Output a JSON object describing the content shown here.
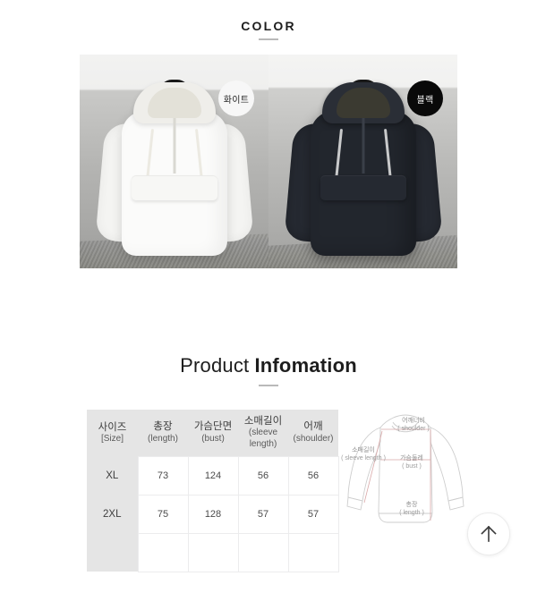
{
  "color_section": {
    "heading": "COLOR",
    "swatches": [
      {
        "badge_label": "화이트",
        "name": "white-colorway"
      },
      {
        "badge_label": "블랙",
        "name": "black-colorway"
      }
    ]
  },
  "product_info": {
    "heading_light": "Product",
    "heading_bold": "Infomation",
    "table": {
      "headers": [
        {
          "kr": "사이즈",
          "en": "[Size]"
        },
        {
          "kr": "총장",
          "en": "(length)"
        },
        {
          "kr": "가슴단면",
          "en": "(bust)"
        },
        {
          "kr": "소매길이",
          "en": "(sleeve length)"
        },
        {
          "kr": "어깨",
          "en": "(shoulder)"
        }
      ],
      "rows": [
        {
          "size": "XL",
          "length": "73",
          "bust": "124",
          "sleeve": "56",
          "shoulder": "56"
        },
        {
          "size": "2XL",
          "length": "75",
          "bust": "128",
          "sleeve": "57",
          "shoulder": "57"
        }
      ]
    },
    "diagram": {
      "shoulder": {
        "kr": "어깨너비",
        "en": "( shoulder )"
      },
      "bust": {
        "kr": "가슴둘레",
        "en": "( bust )"
      },
      "sleeve": {
        "kr": "소매길이",
        "en": "( sleeve length )"
      },
      "length": {
        "kr": "총장",
        "en": "( length )"
      }
    }
  },
  "scroll_top": {
    "label": "↑"
  },
  "colors": {
    "text": "#1d1d1d",
    "table_header_bg": "#e5e5e5",
    "table_border": "#ececed",
    "badge_white_bg": "#f7f7f7",
    "badge_black_bg": "#090909",
    "diagram_line": "#c9c9c9",
    "diagram_guide": "#d9a7a7"
  }
}
